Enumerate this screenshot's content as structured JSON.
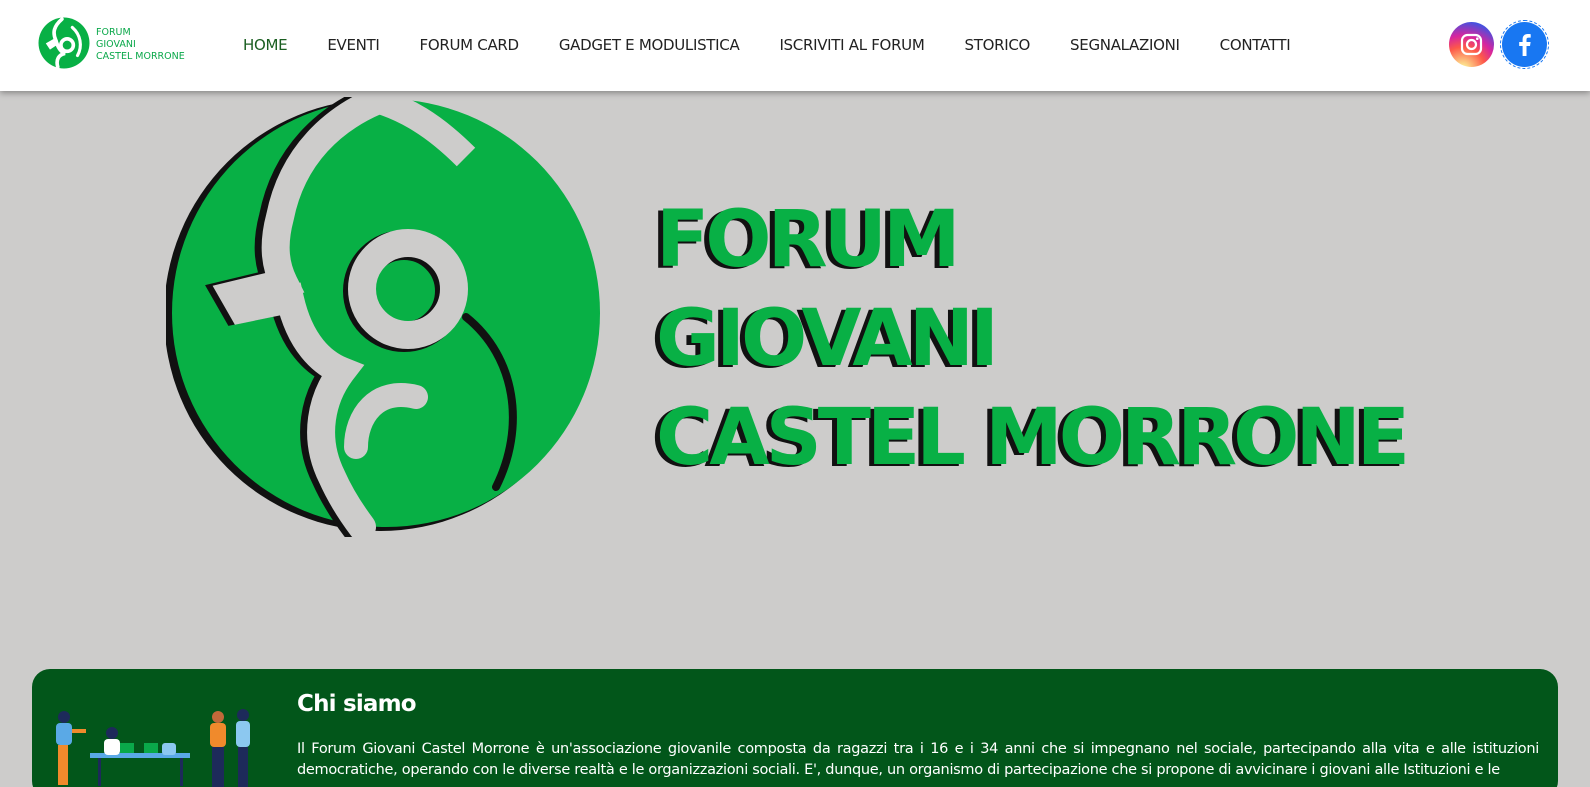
{
  "brand": {
    "logo_icon": "forum-giovani-logo-icon",
    "lines": [
      "FORUM",
      "GIOVANI",
      "CASTEL MORRONE"
    ]
  },
  "nav": {
    "items": [
      {
        "label": "HOME",
        "active": true
      },
      {
        "label": "EVENTI",
        "active": false
      },
      {
        "label": "FORUM CARD",
        "active": false
      },
      {
        "label": "GADGET E MODULISTICA",
        "active": false
      },
      {
        "label": "ISCRIVITI AL FORUM",
        "active": false
      },
      {
        "label": "STORICO",
        "active": false
      },
      {
        "label": "SEGNALAZIONI",
        "active": false
      },
      {
        "label": "CONTATTI",
        "active": false
      }
    ]
  },
  "social": [
    {
      "name": "instagram-icon"
    },
    {
      "name": "facebook-icon"
    }
  ],
  "hero": {
    "title_lines": [
      "FORUM",
      "GIOVANI",
      "CASTEL MORRONE"
    ]
  },
  "about": {
    "heading": "Chi siamo",
    "text": "Il Forum Giovani Castel Morrone è un'associazione giovanile composta da ragazzi tra i 16 e i 34 anni che si impegnano nel sociale, partecipando alla vita e alle istituzioni democratiche, operando con le diverse realtà e le organizzazioni sociali. E', dunque, un organismo di partecipazione che si propone di avvicinare i giovani alle Istituzioni e le"
  },
  "colors": {
    "brand_green": "#08b045",
    "dark_green": "#02561a",
    "hero_background": "#cdcccb",
    "active_nav": "#1a5e20"
  }
}
